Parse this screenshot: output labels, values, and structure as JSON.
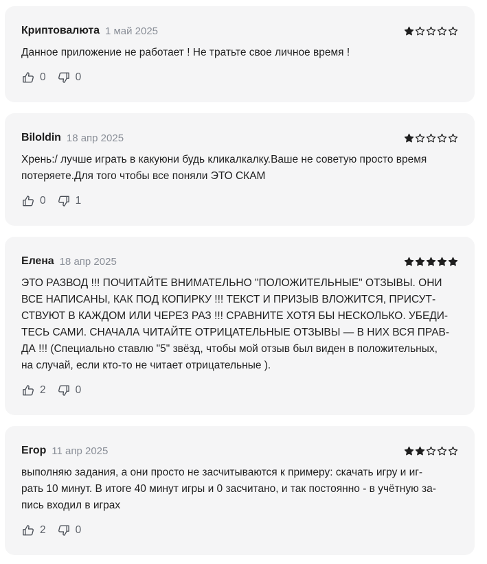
{
  "reviews": [
    {
      "author": "Криптовалюта",
      "date": "1 май 2025",
      "rating": 1,
      "text": "Данное приложение не работает ! Не тратьте свое личное время !",
      "likes": "0",
      "dislikes": "0"
    },
    {
      "author": "Biloldin",
      "date": "18 апр 2025",
      "rating": 1,
      "text": "Хрень:/ лучше играть в какуюни будь кликалкалку.Ваше не советую просто время\nпотеряете.Для того чтобы все поняли ЭТО СКАМ",
      "likes": "0",
      "dislikes": "1"
    },
    {
      "author": "Елена",
      "date": "18 апр 2025",
      "rating": 5,
      "text": "ЭТО РАЗВОД !!! ПОЧИТАЙТЕ ВНИМАТЕЛЬНО \"ПОЛОЖИТЕЛЬНЫЕ\" ОТЗЫВЫ. ОНИ\nВСЕ НАПИСАНЫ, КАК ПОД КОПИРКУ !!! ТЕКСТ И ПРИЗЫВ ВЛОЖИТСЯ, ПРИСУТ-\nСТВУЮТ В КАЖДОМ ИЛИ ЧЕРЕЗ РАЗ !!! СРАВНИТЕ ХОТЯ БЫ НЕСКОЛЬКО. УБЕДИ-\nТЕСЬ САМИ. СНАЧАЛА ЧИТАЙТЕ ОТРИЦАТЕЛЬНЫЕ ОТЗЫВЫ — В НИХ ВСЯ ПРАВ-\nДА !!! (Специально ставлю \"5\" звёзд, чтобы мой отзыв был виден в положительных,\nна случай, если кто-то не читает отрицательные ).",
      "likes": "2",
      "dislikes": "0"
    },
    {
      "author": "Егор",
      "date": "11 апр 2025",
      "rating": 2,
      "text": "выполняю задания, а они просто не засчитываются к примеру: скачать игру и иг-\nрать 10 минут. В итоге 40 минут игры и 0 засчитано, и так постоянно - в учётную за-\nпись входил в играх",
      "likes": "2",
      "dislikes": "0"
    }
  ],
  "icons": {
    "like": "thumbs-up-icon",
    "dislike": "thumbs-down-icon",
    "star_filled": "star-filled-icon",
    "star_empty": "star-outline-icon"
  },
  "colors": {
    "card_bg": "#f5f5f6",
    "star": "#1f1f1f",
    "date": "#8a8f98"
  }
}
